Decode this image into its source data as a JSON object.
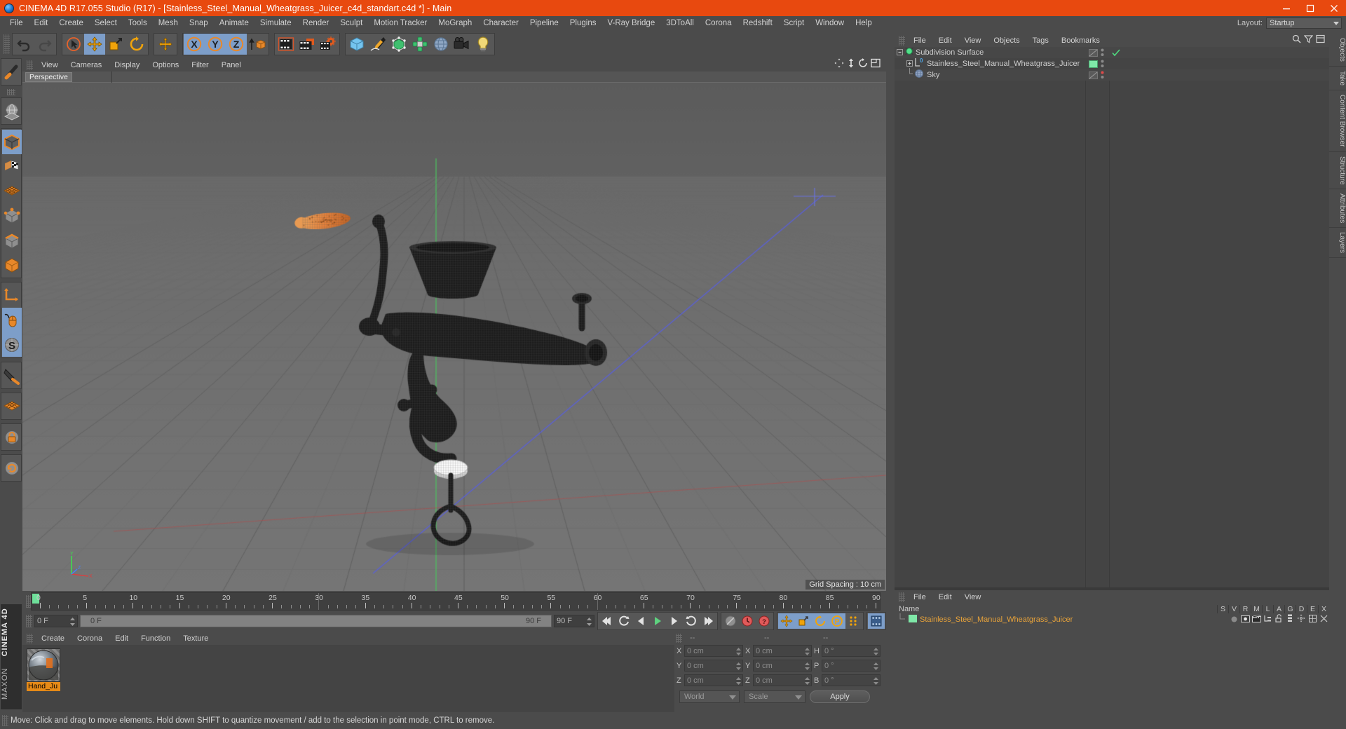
{
  "window": {
    "title": "CINEMA 4D R17.055 Studio (R17) - [Stainless_Steel_Manual_Wheatgrass_Juicer_c4d_standart.c4d *] - Main",
    "app_icon": "c4d-sphere-icon",
    "minimize": "minimize-icon",
    "maximize": "maximize-icon",
    "close": "close-icon",
    "accent_color": "#e8490f",
    "chrome_color": "#4b4b4b"
  },
  "menubar": {
    "items": [
      "File",
      "Edit",
      "Create",
      "Select",
      "Tools",
      "Mesh",
      "Snap",
      "Animate",
      "Simulate",
      "Render",
      "Sculpt",
      "Motion Tracker",
      "MoGraph",
      "Character",
      "Pipeline",
      "Plugins",
      "V-Ray Bridge",
      "3DToAll",
      "Corona",
      "Redshift",
      "Script",
      "Window",
      "Help"
    ],
    "layout_label": "Layout:",
    "layout_value": "Startup"
  },
  "toolbar": {
    "groups": [
      {
        "name": "history",
        "buttons": [
          {
            "icon": "undo-icon",
            "label": "Undo",
            "selected": false
          },
          {
            "icon": "redo-icon",
            "label": "Redo",
            "selected": false
          }
        ]
      },
      {
        "name": "transform-tools",
        "buttons": [
          {
            "icon": "live-selection-icon",
            "label": "Live Selection",
            "selected": false
          },
          {
            "icon": "move-icon",
            "label": "Move",
            "selected": true
          },
          {
            "icon": "scale-icon",
            "label": "Scale",
            "selected": false
          },
          {
            "icon": "rotate-icon",
            "label": "Rotate",
            "selected": false
          }
        ]
      },
      {
        "name": "world-axis",
        "buttons": [
          {
            "icon": "world-coordinates-icon",
            "label": "World/Object",
            "selected": false
          }
        ]
      },
      {
        "name": "axis-locks",
        "buttons": [
          {
            "icon": "axis-x-icon",
            "label": "X Axis",
            "selected": true
          },
          {
            "icon": "axis-y-icon",
            "label": "Y Axis",
            "selected": true
          },
          {
            "icon": "axis-z-icon",
            "label": "Z Axis",
            "selected": true
          },
          {
            "icon": "world-object-toggle-icon",
            "label": "Coordinate System",
            "selected": false
          }
        ]
      },
      {
        "name": "render-tools",
        "buttons": [
          {
            "icon": "render-view-icon",
            "label": "Render View",
            "selected": false
          },
          {
            "icon": "render-region-icon",
            "label": "Render to Picture Viewer",
            "selected": false
          },
          {
            "icon": "render-settings-icon",
            "label": "Edit Render Settings",
            "selected": false
          }
        ]
      },
      {
        "name": "create-objects",
        "buttons": [
          {
            "icon": "cube-primitive-icon",
            "label": "Add Cube Object",
            "selected": false
          },
          {
            "icon": "spline-pen-icon",
            "label": "Add Spline",
            "selected": false
          },
          {
            "icon": "generator-icon",
            "label": "Add Generator",
            "selected": false
          },
          {
            "icon": "deformer-icon",
            "label": "Add Deformer",
            "selected": false
          },
          {
            "icon": "environment-icon",
            "label": "Add Environment",
            "selected": false
          },
          {
            "icon": "camera-icon",
            "label": "Add Camera",
            "selected": false
          },
          {
            "icon": "light-icon",
            "label": "Add Light",
            "selected": false
          }
        ]
      }
    ]
  },
  "left_palette": {
    "groups": [
      {
        "buttons": [
          {
            "icon": "magnet-icon",
            "label": "Magnet",
            "selected": false
          }
        ]
      },
      {
        "buttons": [
          {
            "icon": "workplane-icon",
            "label": "Workplane",
            "selected": false
          }
        ]
      },
      {
        "buttons": [
          {
            "icon": "model-mode-icon",
            "label": "Model Mode",
            "selected": true
          },
          {
            "icon": "texture-mode-icon",
            "label": "Texture Mode",
            "selected": false
          },
          {
            "icon": "polygon-mode-icon",
            "label": "Polygon Mode",
            "selected": false
          },
          {
            "icon": "point-mode-icon",
            "label": "Point Mode",
            "selected": false
          },
          {
            "icon": "edge-mode-icon",
            "label": "Edge Mode",
            "selected": false
          },
          {
            "icon": "object-mode-icon",
            "label": "Object Mode",
            "selected": false
          }
        ]
      },
      {
        "buttons": [
          {
            "icon": "axis-modify-icon",
            "label": "Enable Axis Modification",
            "selected": false
          },
          {
            "icon": "viewport-solo-icon",
            "label": "Viewport Solo",
            "selected": true
          },
          {
            "icon": "snap-enable-icon",
            "label": "Enable Snap",
            "selected": true
          }
        ]
      },
      {
        "buttons": [
          {
            "icon": "knife-icon",
            "label": "Knife",
            "selected": false
          }
        ]
      },
      {
        "buttons": [
          {
            "icon": "array-icon",
            "label": "Array",
            "selected": false
          }
        ]
      },
      {
        "buttons": [
          {
            "icon": "lock-icon",
            "label": "Lock",
            "selected": false
          }
        ]
      },
      {
        "buttons": [
          {
            "icon": "reset-psr-icon",
            "label": "Reset PSR",
            "selected": false
          }
        ]
      }
    ],
    "brand_line1": "MAXON",
    "brand_line2": "CINEMA 4D"
  },
  "viewport": {
    "menu": [
      "View",
      "Cameras",
      "Display",
      "Options",
      "Filter",
      "Panel"
    ],
    "tab": "Perspective",
    "grid_spacing": "Grid Spacing : 10 cm",
    "corner_icons": [
      "pan-icon",
      "dolly-icon",
      "rotate-view-icon",
      "maximize-view-icon"
    ],
    "axis_labels": [
      "Y",
      "X",
      "Z"
    ]
  },
  "timeline": {
    "start_frame": "0 F",
    "current_frame": "0 F",
    "range_start": "0 F",
    "range_end": "90 F",
    "end_frame": "90 F",
    "ticks": [
      "0",
      "5",
      "10",
      "15",
      "20",
      "25",
      "30",
      "35",
      "40",
      "45",
      "50",
      "55",
      "60",
      "65",
      "70",
      "75",
      "80",
      "85",
      "90"
    ],
    "playhead_frame": 0,
    "transport": [
      {
        "icon": "goto-start-icon",
        "label": "Go to Start"
      },
      {
        "icon": "prev-key-icon",
        "label": "Go to Previous Key"
      },
      {
        "icon": "prev-frame-icon",
        "label": "Go to Previous Frame"
      },
      {
        "icon": "play-icon",
        "label": "Play Forwards"
      },
      {
        "icon": "next-frame-icon",
        "label": "Go to Next Frame"
      },
      {
        "icon": "next-key-icon",
        "label": "Go to Next Key"
      },
      {
        "icon": "goto-end-icon",
        "label": "Go to End"
      }
    ],
    "record_tools": [
      {
        "icon": "record-disabled-icon",
        "label": "Record Active Objects",
        "selected": false
      },
      {
        "icon": "autokey-icon",
        "label": "Autokeying",
        "selected": false
      },
      {
        "icon": "keyframe-selection-icon",
        "label": "Keyframe Selection",
        "selected": false
      }
    ],
    "key_toggles": [
      {
        "icon": "position-key-icon",
        "label": "Position",
        "selected": true
      },
      {
        "icon": "scale-key-icon",
        "label": "Scale",
        "selected": true
      },
      {
        "icon": "rotation-key-icon",
        "label": "Rotation",
        "selected": true
      },
      {
        "icon": "param-key-icon",
        "label": "Parameter",
        "selected": true
      },
      {
        "icon": "pla-key-icon",
        "label": "Point Level Animation",
        "selected": false
      },
      {
        "icon": "timeline-icon",
        "label": "Timeline",
        "selected": false
      }
    ]
  },
  "material_manager": {
    "menu": [
      "Create",
      "Corona",
      "Edit",
      "Function",
      "Texture"
    ],
    "materials": [
      {
        "name": "Hand_Ju",
        "full_name": "Hand_Juicer",
        "selected": true,
        "preview": "sphere-chrome-preview"
      }
    ]
  },
  "coordinates": {
    "header": [
      "--",
      "--",
      "--"
    ],
    "rows": [
      {
        "pos_label": "X",
        "pos_value": "0 cm",
        "size_label": "X",
        "size_value": "0 cm",
        "rot_label": "H",
        "rot_value": "0 °"
      },
      {
        "pos_label": "Y",
        "pos_value": "0 cm",
        "size_label": "Y",
        "size_value": "0 cm",
        "rot_label": "P",
        "rot_value": "0 °"
      },
      {
        "pos_label": "Z",
        "pos_value": "0 cm",
        "size_label": "Z",
        "size_value": "0 cm",
        "rot_label": "B",
        "rot_value": "0 °"
      }
    ],
    "system": "World",
    "mode": "Scale",
    "apply": "Apply"
  },
  "object_manager": {
    "menu": [
      "File",
      "Edit",
      "View",
      "Objects",
      "Tags",
      "Bookmarks"
    ],
    "items": [
      {
        "name": "Subdivision Surface",
        "icon": "subdivision-surface-icon",
        "depth": 0,
        "expander": "minus",
        "tag_color": "none",
        "visible_dot": "gray",
        "check": true
      },
      {
        "name": "Stainless_Steel_Manual_Wheatgrass_Juicer",
        "icon": "null-layer-icon",
        "depth": 1,
        "expander": "plus",
        "tag_color": "#7fe8a8",
        "visible_dot": "gray",
        "check": false
      },
      {
        "name": "Sky",
        "icon": "sky-icon",
        "depth": 1,
        "expander": "none",
        "tag_color": "none",
        "visible_dot": "red",
        "check": false
      }
    ]
  },
  "structure_manager": {
    "menu": [
      "File",
      "Edit",
      "View"
    ],
    "name_header": "Name",
    "columns": [
      "S",
      "V",
      "R",
      "M",
      "L",
      "A",
      "G",
      "D",
      "E",
      "X"
    ],
    "rows": [
      {
        "name": "Stainless_Steel_Manual_Wheatgrass_Juicer",
        "swatch": "#7fe8a8",
        "icons": [
          "dot-icon",
          "visible-icon",
          "render-icon",
          "hierarchy-icon",
          "unlock-icon",
          "layer-icon",
          "axis-icon",
          "deform-icon",
          "expand-icon"
        ]
      }
    ]
  },
  "right_tabs": [
    "Objects",
    "Take",
    "Content Browser",
    "Structure",
    "Attributes",
    "Layers"
  ],
  "statusbar": {
    "message": "Move: Click and drag to move elements. Hold down SHIFT to quantize movement / add to the selection in point mode, CTRL to remove."
  }
}
